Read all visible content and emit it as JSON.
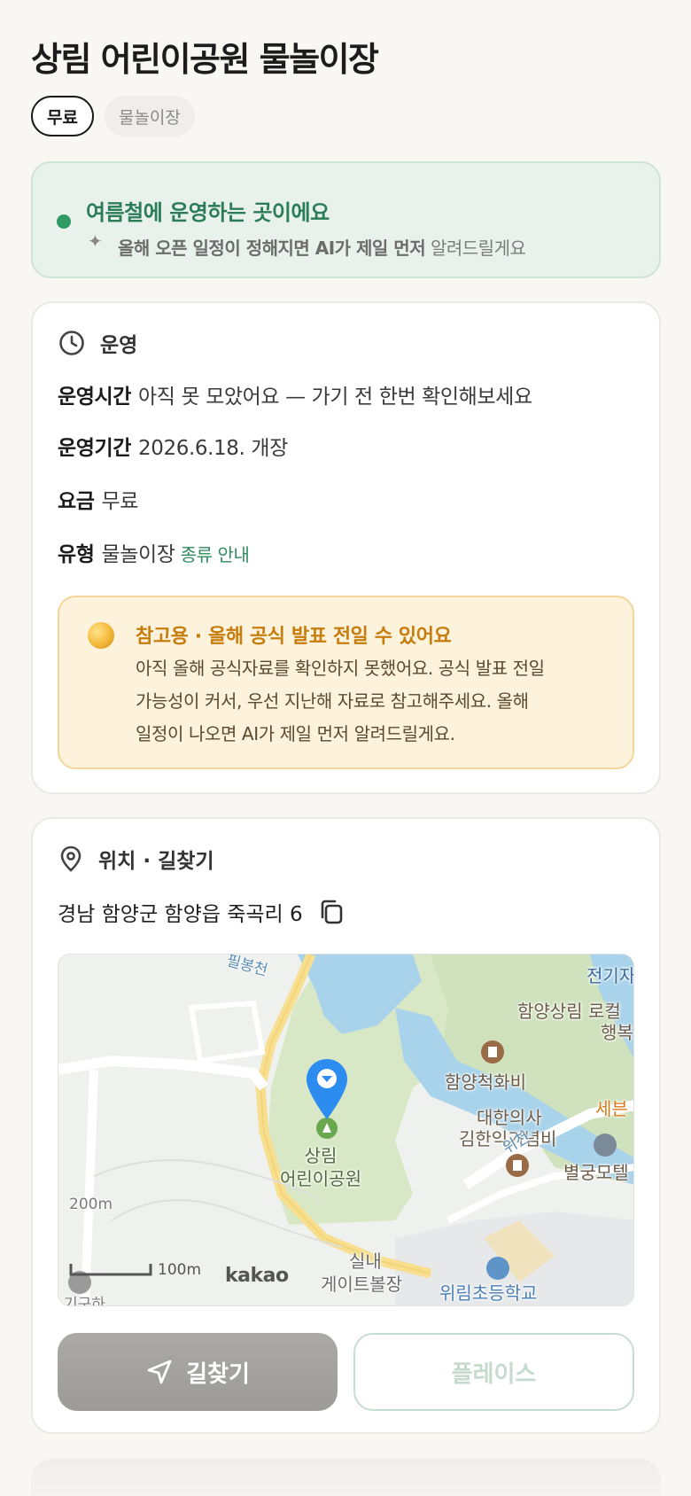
{
  "title": "상림 어린이공원 물놀이장",
  "chips": {
    "price": "무료",
    "type": "물놀이장"
  },
  "season_banner": {
    "heading": "여름철에 운영하는 곳이에요",
    "sparkle_icon": "sparkle-icon",
    "sub_bold": "올해 오픈 일정이 정해지면 AI가 제일 먼저",
    "sub_rest": " 알려드릴게요",
    "accent_color": "#2f9a63"
  },
  "operation": {
    "heading": "운영",
    "icon": "clock-icon",
    "rows": [
      {
        "key": "운영시간",
        "value": "아직 못 모았어요 — 가기 전 한번 확인해보세요"
      },
      {
        "key": "운영기간",
        "value": "2026.6.18. 개장"
      },
      {
        "key": "요금",
        "value": "무료"
      },
      {
        "key": "유형",
        "value": "물놀이장",
        "link": "종류 안내"
      }
    ],
    "notice": {
      "heading": "참고용 · 올해 공식 발표 전일 수 있어요",
      "lines": [
        "아직 올해 공식자료를 확인하지 못했어요. 공식 발표 전일",
        "가능성이 커서, 우선 지난해 자료로 참고해주세요. 올해",
        "일정이 나오면 AI가 제일 먼저 알려드릴게요."
      ],
      "color": "#c77d0c"
    }
  },
  "location": {
    "heading": "위치 · 길찾기",
    "icon": "location-pin-icon",
    "address": "경남 함양군 함양읍 죽곡리 6",
    "copy_icon": "copy-icon",
    "map": {
      "labels": {
        "park": [
          "상림",
          "어린이공원"
        ],
        "monument1": "함양척화비",
        "monument2_l1": "대한의사",
        "monument2_l2": "김한익기념비",
        "museum_l1": "함양상림 로컬",
        "museum_l2": "행복",
        "electric": "전기자",
        "motel": "별궁모텔",
        "sebeun": "세븐",
        "parking_l1": "실내",
        "parking_l2": "게이트볼장",
        "school": "위림초등학교",
        "river": "위천",
        "stream": "필봉천",
        "elev": "200m",
        "scale": "100m",
        "brand": "kakao",
        "bottom_left": "기구하"
      }
    },
    "buttons": {
      "directions": "길찾기",
      "directions_icon": "navigation-arrow-icon",
      "place": "플레이스"
    }
  }
}
